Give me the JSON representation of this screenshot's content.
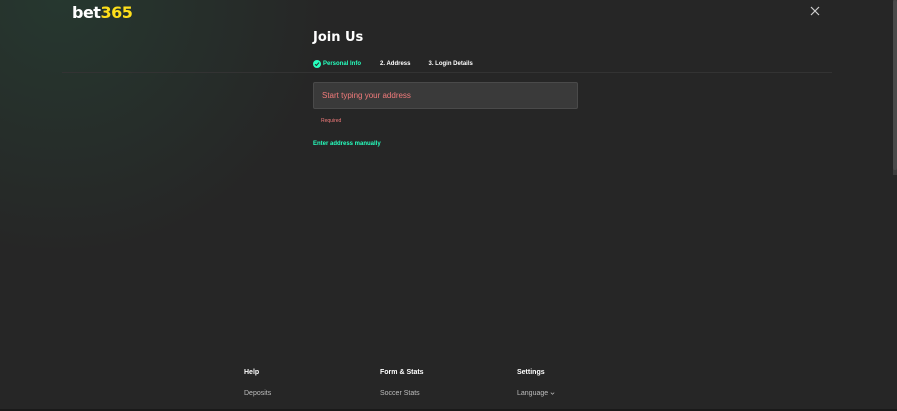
{
  "header": {
    "logo_text": "bet",
    "logo_accent": "365"
  },
  "form": {
    "title": "Join Us",
    "steps": [
      {
        "label": "Personal Info",
        "state": "done"
      },
      {
        "label": "2. Address",
        "state": "active"
      },
      {
        "label": "3. Login Details",
        "state": "pending"
      }
    ],
    "address_placeholder": "Start typing your address",
    "address_value": "",
    "error_text": "Required",
    "manual_link": "Enter address manually"
  },
  "footer": {
    "columns": [
      {
        "heading": "Help",
        "link": "Deposits"
      },
      {
        "heading": "Form & Stats",
        "link": "Soccer Stats"
      },
      {
        "heading": "Settings",
        "link": "Language"
      }
    ]
  },
  "colors": {
    "background": "#262626",
    "accent_green": "#26ffbe",
    "logo_yellow": "#ffdf1b",
    "error_red": "#f27b7b"
  }
}
